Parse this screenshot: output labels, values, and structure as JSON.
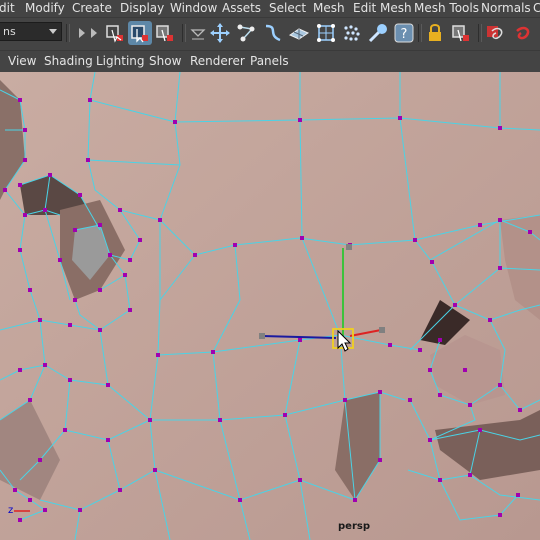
{
  "menubar": {
    "items": [
      "dit",
      "Modify",
      "Create",
      "Display",
      "Window",
      "Assets",
      "Select",
      "Mesh",
      "Edit Mesh",
      "Mesh Tools",
      "Normals",
      "C"
    ]
  },
  "shelf": {
    "mode_value": "ns",
    "tools": [
      "select-by-hierarchy-icon",
      "select-by-component-icon",
      "select-by-object-icon",
      "move-tool-icon",
      "soft-select-icon",
      "curve-snap-icon",
      "grid-snap-icon",
      "point-snap-icon",
      "view-snap-icon",
      "live-surface-icon",
      "magnet-icon",
      "help-icon",
      "lock-icon",
      "history-icon",
      "render-icon",
      "ipr-render-icon"
    ]
  },
  "panel_menu": {
    "items": [
      "View",
      "Shading",
      "Lighting",
      "Show",
      "Renderer",
      "Panels"
    ]
  },
  "viewport": {
    "camera": "persp",
    "axis_label": "z",
    "surface_color": "#c4a69c",
    "wire_color": "#4ad3e6",
    "vertex_color": "#a000b0"
  }
}
